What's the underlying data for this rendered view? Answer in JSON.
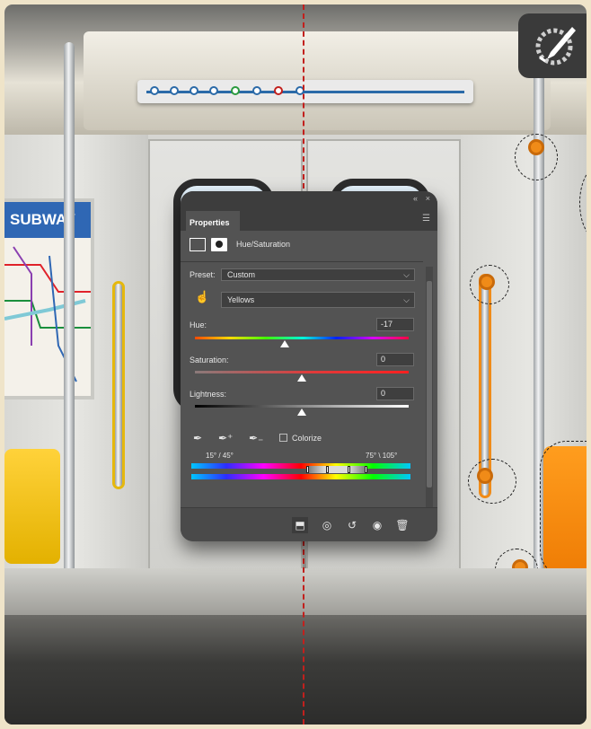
{
  "background": {
    "poster_title": "SUBWAY",
    "accent_colors": {
      "guide_line": "#c2201d",
      "seat_left": "#ffd23a",
      "seat_right": "#ff9d1e",
      "panel_bg": "#535353"
    }
  },
  "toolbar_icon": {
    "name": "brush-eraser-tool-icon"
  },
  "properties_panel": {
    "top_controls": {
      "collapse": "«",
      "close": "×"
    },
    "tab_label": "Properties",
    "adjustment_title": "Hue/Saturation",
    "preset_label": "Preset:",
    "preset_value": "Custom",
    "channel_value": "Yellows",
    "hue_label": "Hue:",
    "hue_value": "-17",
    "saturation_label": "Saturation:",
    "saturation_value": "0",
    "lightness_label": "Lightness:",
    "lightness_value": "0",
    "colorize_label": "Colorize",
    "range_left": "15° / 45°",
    "range_right": "75° \\ 105°",
    "hue_level": 0.42,
    "saturation_level": 0.5,
    "lightness_level": 0.5
  }
}
